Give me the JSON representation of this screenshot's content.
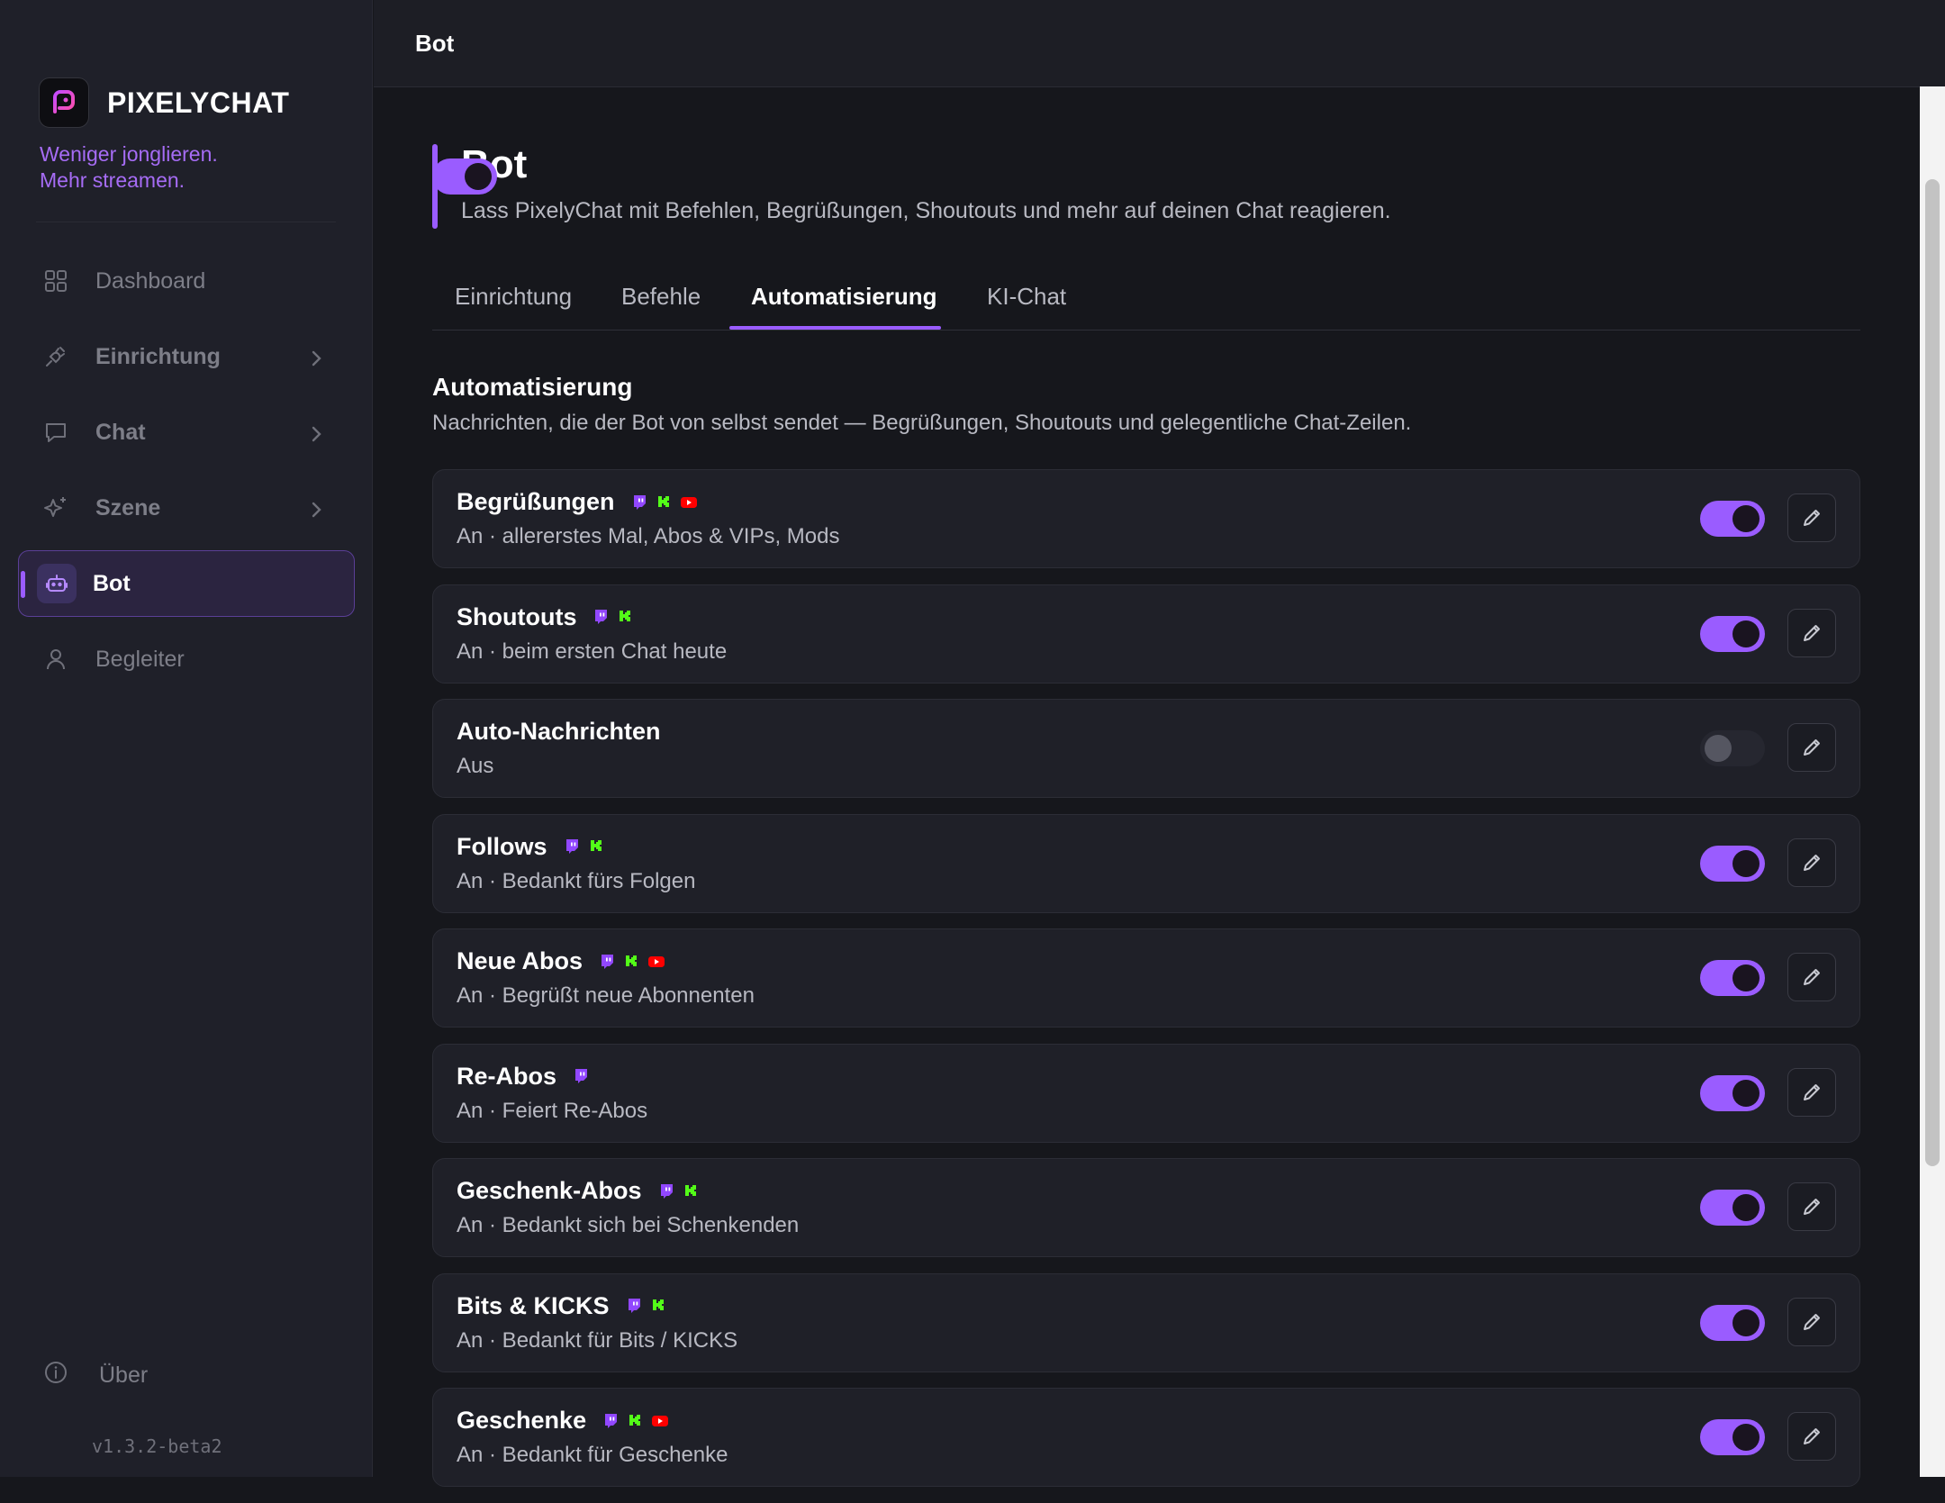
{
  "app": {
    "name": "PIXELYCHAT",
    "tagline_line1": "Weniger jonglieren.",
    "tagline_line2": "Mehr streamen.",
    "version": "v1.3.2-beta2",
    "accent_color": "#9a5cff"
  },
  "sidebar": {
    "items": [
      {
        "label": "Dashboard",
        "icon": "grid-icon"
      },
      {
        "label": "Einrichtung",
        "icon": "plug-icon"
      },
      {
        "label": "Chat",
        "icon": "chat-bubble-icon"
      },
      {
        "label": "Szene",
        "icon": "sparkle-icon"
      },
      {
        "label": "Bot",
        "icon": "robot-icon",
        "active": true
      },
      {
        "label": "Begleiter",
        "icon": "user-icon"
      }
    ],
    "about_label": "Über"
  },
  "topbar": {
    "title": "Bot"
  },
  "header": {
    "title": "Bot",
    "subtitle": "Lass PixelyChat mit Befehlen, Begrüßungen, Shoutouts und mehr auf deinen Chat reagieren.",
    "enabled": true
  },
  "tabs": [
    {
      "label": "Einrichtung"
    },
    {
      "label": "Befehle"
    },
    {
      "label": "Automatisierung",
      "active": true
    },
    {
      "label": "KI-Chat"
    }
  ],
  "section": {
    "title": "Automatisierung",
    "subtitle": "Nachrichten, die der Bot von selbst sendet — Begrüßungen, Shoutouts und gelegentliche Chat-Zeilen."
  },
  "automations": [
    {
      "title": "Begrüßungen",
      "status": "An · allererstes Mal, Abos & VIPs, Mods",
      "enabled": true,
      "platforms": [
        "twitch-icon",
        "kick-icon",
        "youtube-icon"
      ]
    },
    {
      "title": "Shoutouts",
      "status": "An · beim ersten Chat heute",
      "enabled": true,
      "platforms": [
        "twitch-icon",
        "kick-icon"
      ]
    },
    {
      "title": "Auto-Nachrichten",
      "status": "Aus",
      "enabled": false,
      "platforms": []
    },
    {
      "title": "Follows",
      "status": "An · Bedankt fürs Folgen",
      "enabled": true,
      "platforms": [
        "twitch-icon",
        "kick-icon"
      ]
    },
    {
      "title": "Neue Abos",
      "status": "An · Begrüßt neue Abonnenten",
      "enabled": true,
      "platforms": [
        "twitch-icon",
        "kick-icon",
        "youtube-icon"
      ]
    },
    {
      "title": "Re-Abos",
      "status": "An · Feiert Re-Abos",
      "enabled": true,
      "platforms": [
        "twitch-icon"
      ]
    },
    {
      "title": "Geschenk-Abos",
      "status": "An · Bedankt sich bei Schenkenden",
      "enabled": true,
      "platforms": [
        "twitch-icon",
        "kick-icon"
      ]
    },
    {
      "title": "Bits & KICKS",
      "status": "An · Bedankt für Bits / KICKS",
      "enabled": true,
      "platforms": [
        "twitch-icon",
        "kick-icon"
      ]
    },
    {
      "title": "Geschenke",
      "status": "An · Bedankt für Geschenke",
      "enabled": true,
      "platforms": [
        "twitch-icon",
        "kick-icon",
        "youtube-icon"
      ]
    }
  ]
}
